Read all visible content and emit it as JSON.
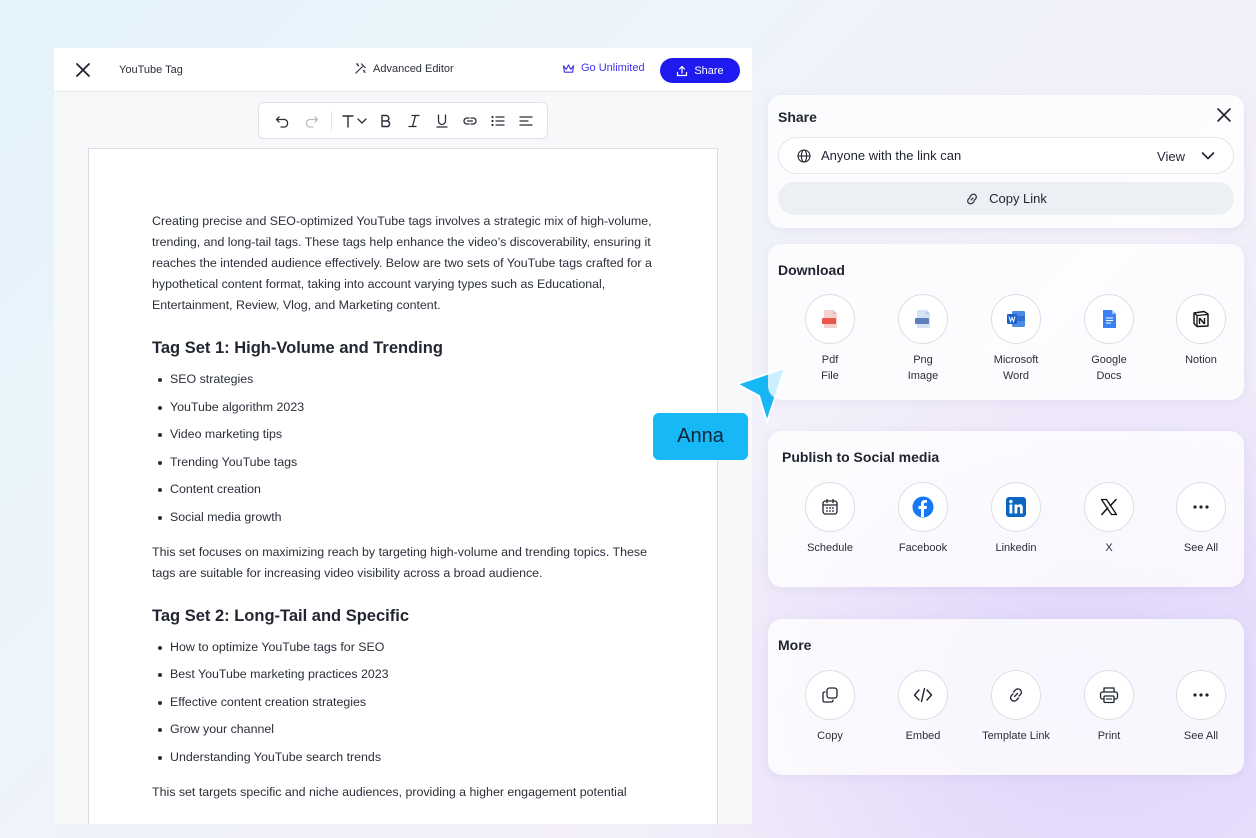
{
  "editor": {
    "doc_title": "YouTube Tag",
    "advanced_editor": "Advanced Editor",
    "go_unlimited": "Go Unlimited",
    "share": "Share"
  },
  "document": {
    "intro": "Creating precise and SEO-optimized YouTube tags involves a strategic mix of high-volume, trending, and long-tail tags. These tags help enhance the video’s discoverability, ensuring it reaches the intended audience effectively. Below are two sets of YouTube tags crafted for a hypothetical content format, taking into account varying types such as Educational, Entertainment, Review, Vlog, and Marketing content.",
    "set1_heading": "Tag Set 1: High-Volume and Trending",
    "set1_items": [
      "SEO strategies",
      "YouTube algorithm 2023",
      "Video marketing tips",
      "Trending YouTube tags",
      "Content creation",
      "Social media growth"
    ],
    "set1_summary": "This set focuses on maximizing reach by targeting high-volume and trending topics. These tags are suitable for increasing video visibility across a broad audience.",
    "set2_heading": "Tag Set 2: Long-Tail and Specific",
    "set2_items": [
      "How to optimize YouTube tags for SEO",
      "Best YouTube marketing practices 2023",
      "Effective content creation strategies",
      "Grow your channel",
      "Understanding YouTube search trends"
    ],
    "set2_summary": "This set targets specific and niche audiences, providing a higher engagement potential"
  },
  "cursor": {
    "name": "Anna",
    "color": "#16b8f5"
  },
  "share_panel": {
    "title": "Share",
    "access": "Anyone with the link can",
    "permission": "View",
    "copy_link": "Copy Link"
  },
  "download": {
    "title": "Download",
    "items": [
      {
        "label": "Pdf File",
        "icon": "pdf-file-icon"
      },
      {
        "label": "Png Image",
        "icon": "png-image-icon"
      },
      {
        "label": "Microsoft Word",
        "icon": "microsoft-word-icon"
      },
      {
        "label": "Google Docs",
        "icon": "google-docs-icon"
      },
      {
        "label": "Notion",
        "icon": "notion-icon"
      }
    ]
  },
  "publish": {
    "title": "Publish to Social media",
    "items": [
      {
        "label": "Schedule",
        "icon": "calendar-icon"
      },
      {
        "label": "Facebook",
        "icon": "facebook-icon"
      },
      {
        "label": "Linkedin",
        "icon": "linkedin-icon"
      },
      {
        "label": "X",
        "icon": "x-icon"
      },
      {
        "label": "See All",
        "icon": "more-icon"
      }
    ]
  },
  "more": {
    "title": "More",
    "items": [
      {
        "label": "Copy",
        "icon": "copy-icon"
      },
      {
        "label": "Embed",
        "icon": "embed-code-icon"
      },
      {
        "label": "Template Link",
        "icon": "link-icon"
      },
      {
        "label": "Print",
        "icon": "printer-icon"
      },
      {
        "label": "See All",
        "icon": "more-icon"
      }
    ]
  },
  "colors": {
    "primary": "#1f1bf0",
    "accent_text": "#3d33e8",
    "pdf": "#e8574a",
    "word": "#1d5fc9",
    "docs": "#3b82f6",
    "facebook": "#1877f2",
    "linkedin": "#0a66c2"
  }
}
